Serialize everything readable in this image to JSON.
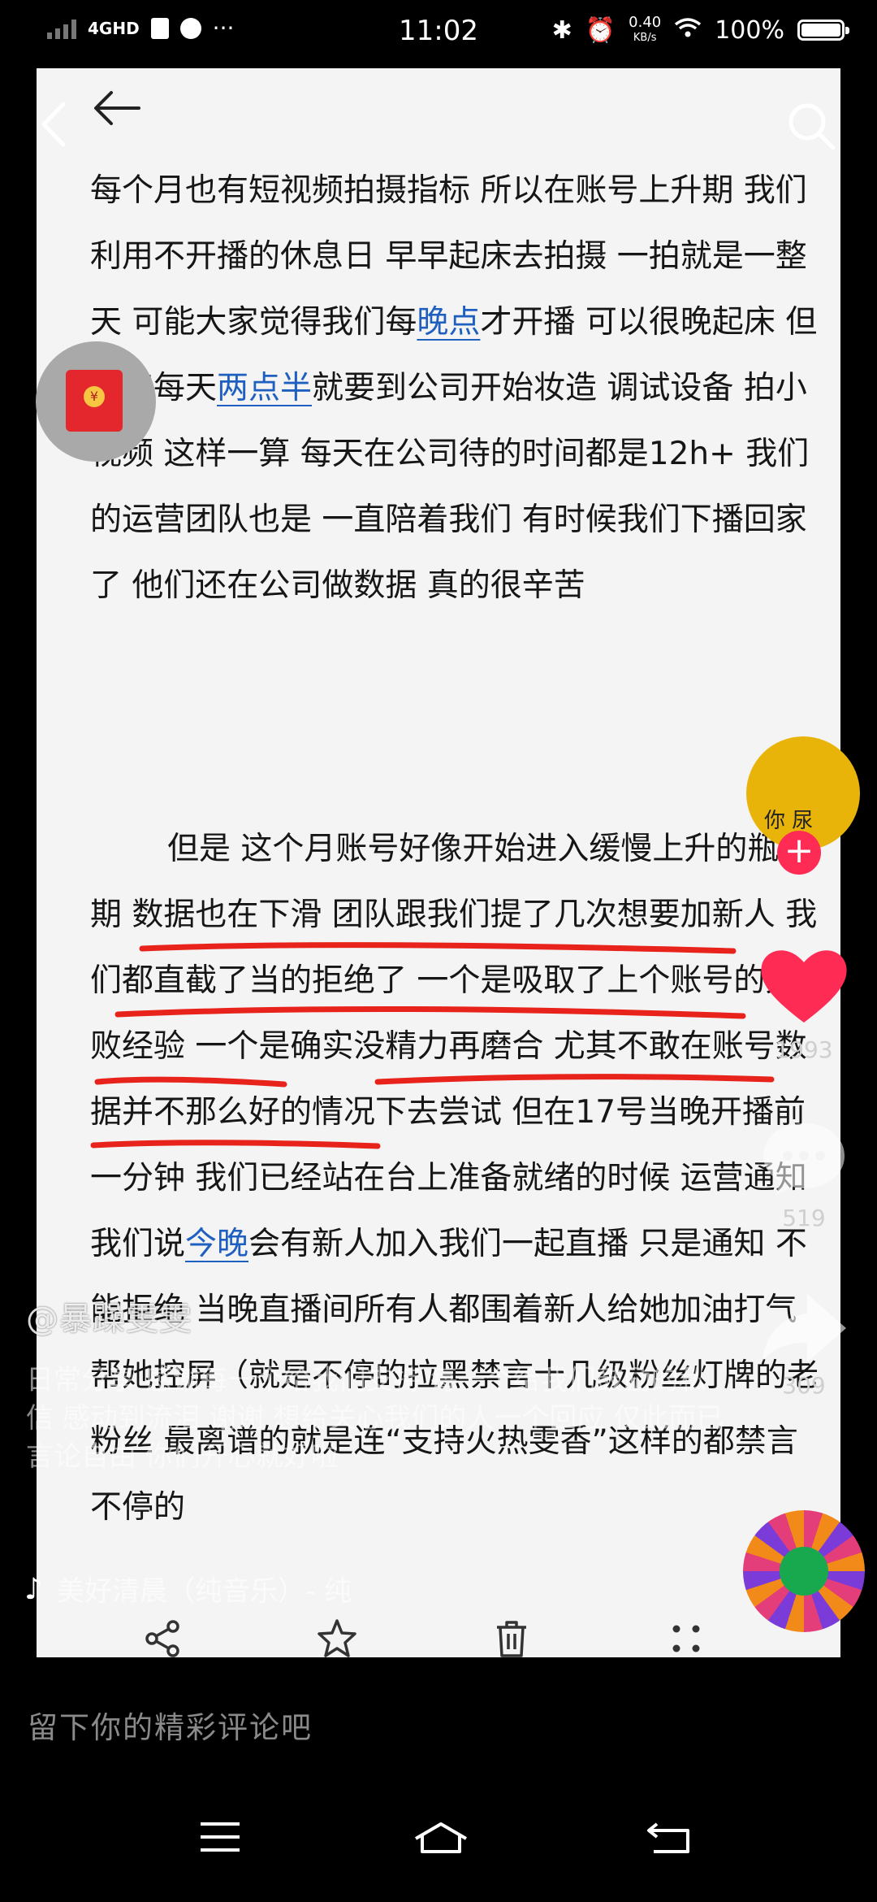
{
  "status_bar": {
    "network": "4GHD",
    "time": "11:02",
    "net_speed_value": "0.40",
    "net_speed_unit": "KB/s",
    "battery": "100%",
    "more": "···"
  },
  "document": {
    "paragraph1": {
      "t1": "每个月也有短视频拍摄指标 所以在账号上升期 我们利用不开播的休息日 早早起床去拍摄 一拍就是一整天 可能大家觉得我们每",
      "l1": "晚点",
      "t2": "才开播 可以很晚起床 但其实每天",
      "l2": "两点半",
      "t3": "就要到公司开始妆造 调试设备 拍小视频 这样一算 每天在公司待的时间都是12h+ 我们的运营团队也是 一直陪着我们 有时候我们下播回家了 他们还在公司做数据 真的很辛苦"
    },
    "paragraph2": {
      "t1": "但是 这个月账号好像开始进入缓慢上升的瓶颈期 数据也在下滑 团队跟我们提了几次想要加新人 我们都直截了当的拒绝了 一个是吸取了上个账号的失败经验 一个是确实没精力再磨合 尤其不敢在账号数据并不那么好的情况下去尝试 但在17号当晚开播前一分钟 我们已经站在台上准备就绪的时候 运营通知我们说",
      "l1": "今晚",
      "t2": "会有新人加入我们一起直播 只是通知 不能拒绝 当晚直播间所有人都围着新人给她加油打气 帮她控屏（就是不停的拉黑禁言十几级粉丝灯牌的老粉丝 最离谱的就是连“支持火热雯香”这样的都禁言 不停的"
    }
  },
  "video_overlay": {
    "author": "@暴躁雯雯",
    "description": "日常分享 感谢每一个给我们支持 每一个给我们鼓励的私信 感动到流泪 谢谢 想给关心我们的人一个回应 仅此而已 言论自由 你们开心就好啦",
    "music": "美好清晨（纯音乐）- 纯",
    "avatar_badge": "你 尿"
  },
  "right_rail": {
    "like_count": "1993",
    "comment_count": "519",
    "share_count": "309"
  },
  "action_bar": {
    "share": "分享",
    "favorite": "收藏",
    "delete": "删除",
    "more": "更多"
  },
  "comment_placeholder": "留下你的精彩评论吧",
  "colors": {
    "link": "#1f5fbf",
    "underline_marker": "#e8231b",
    "like": "#fe2c55"
  }
}
